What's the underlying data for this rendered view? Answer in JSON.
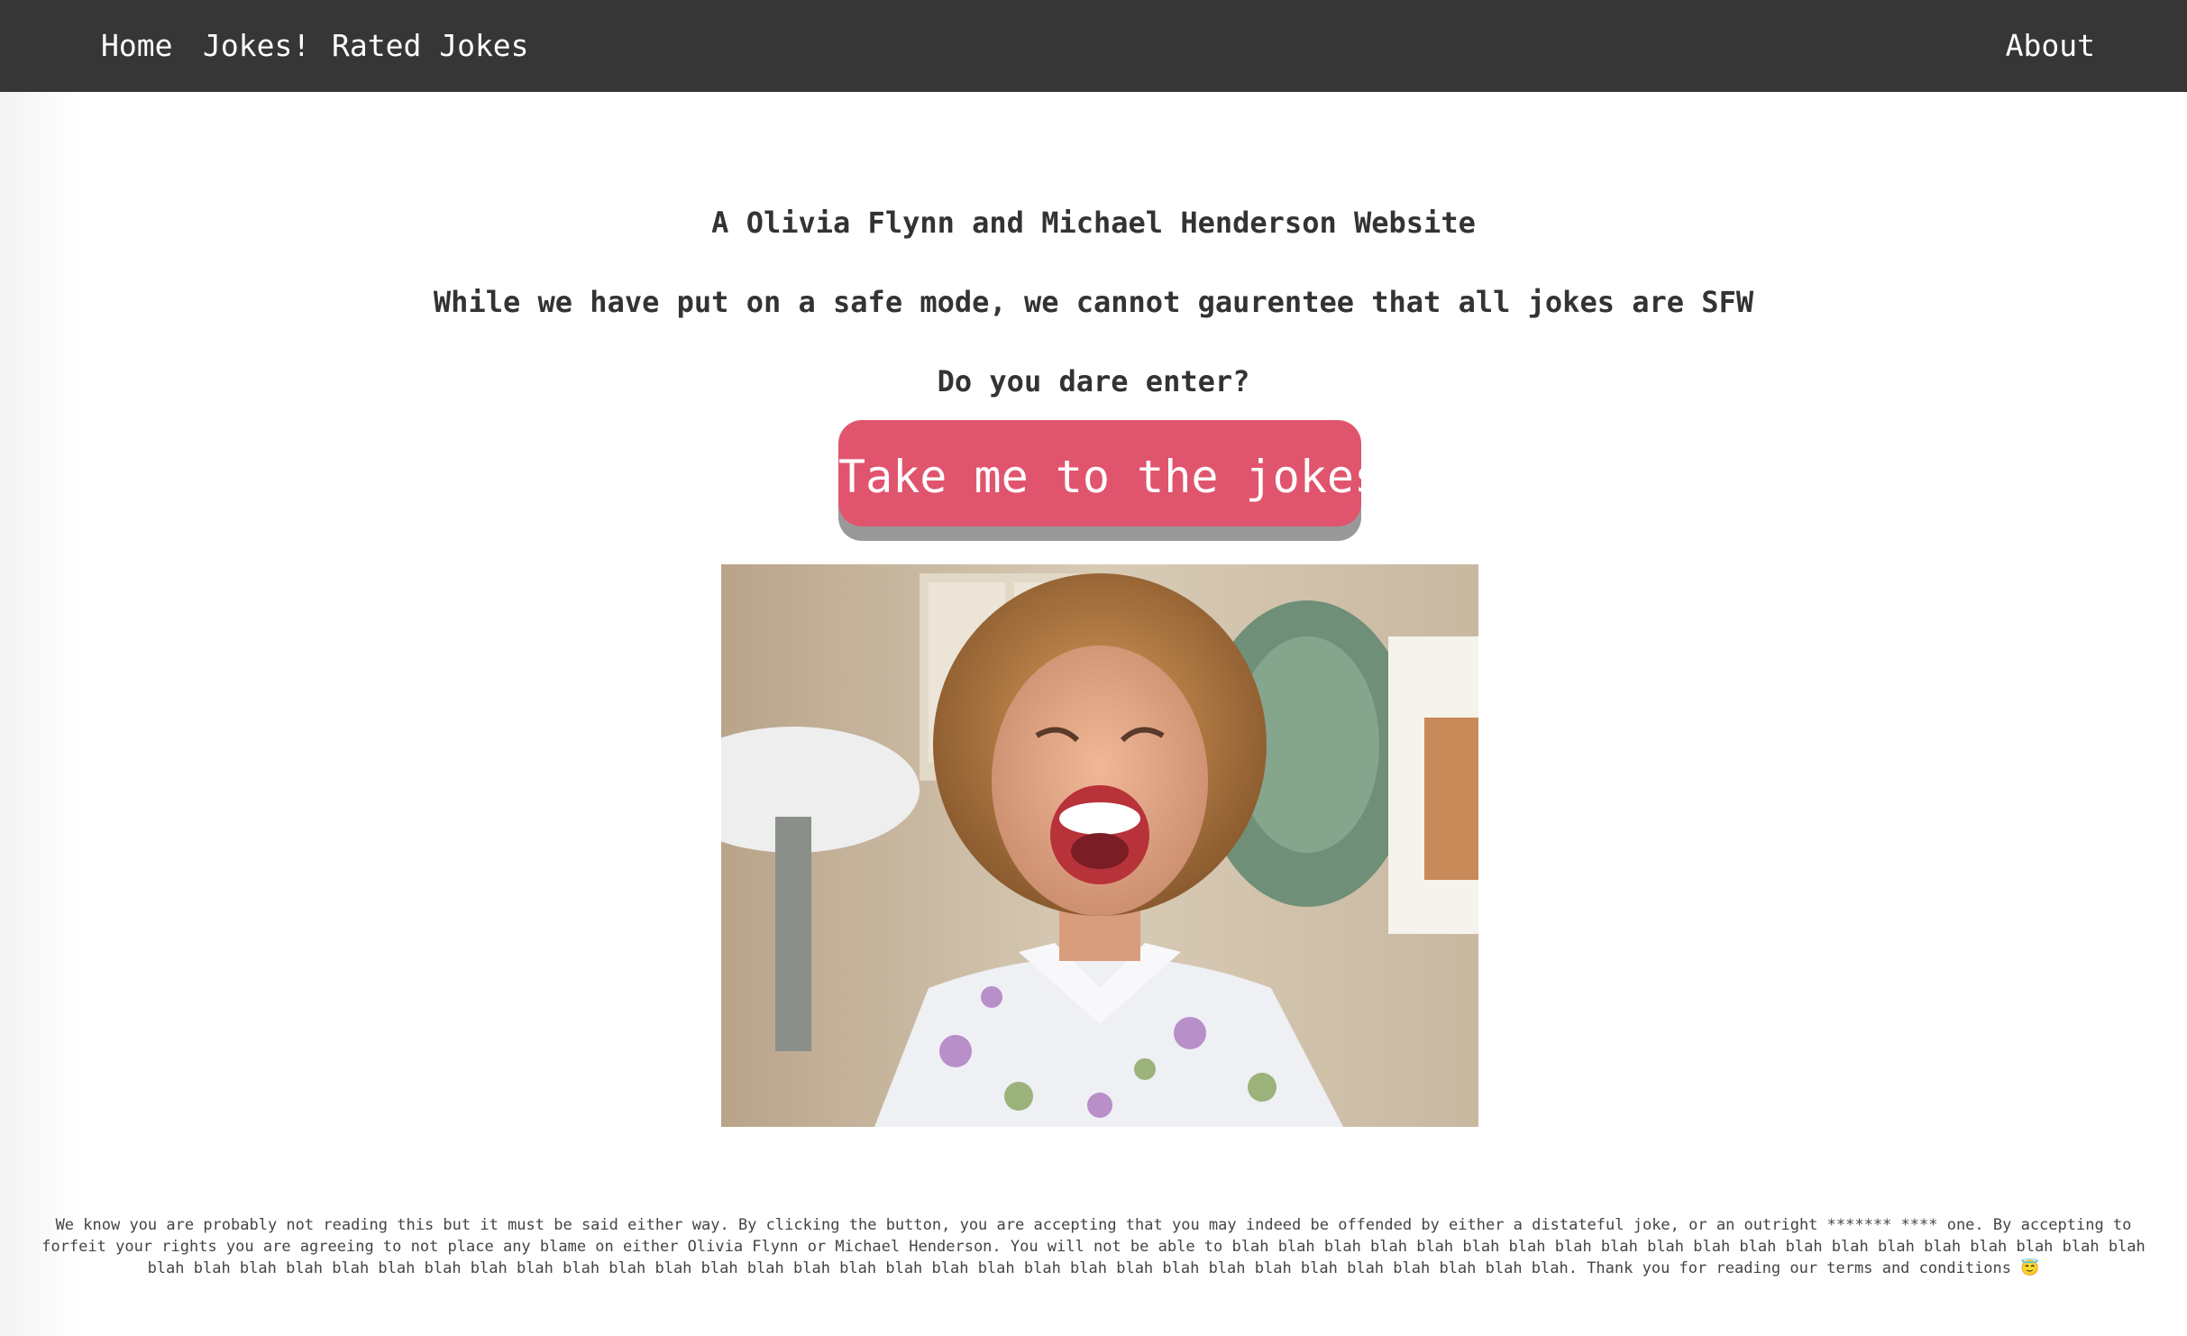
{
  "nav": {
    "home": "Home",
    "jokes": "Jokes!",
    "rated": "Rated Jokes",
    "about": "About"
  },
  "intro": {
    "line1": "A Olivia Flynn and Michael Henderson Website",
    "line2": "While we have put on a safe mode, we cannot gaurentee that all jokes are SFW",
    "line3": "Do you dare enter?"
  },
  "cta": {
    "label": "Take me to the jokes"
  },
  "image": {
    "subject": "laughing-woman-gif"
  },
  "disclaimer": {
    "text": "We know you are probably not reading this but it must be said either way. By clicking the button, you are accepting that you may indeed be offended by either a distateful joke, or an outright ******* **** one. By accepting to forfeit your rights you are agreeing to not place any blame on either Olivia Flynn or Michael Henderson. You will not be able to blah blah blah blah blah blah blah blah blah blah blah blah blah blah blah blah blah blah blah blah blah blah blah blah blah blah blah blah blah blah blah blah blah blah blah blah blah blah blah blah blah blah blah blah blah blah blah blah blah blah blah. Thank you for reading our terms and conditions 😇"
  },
  "colors": {
    "navbar": "#363636",
    "button": "#e0556d",
    "button_shadow": "#999999"
  }
}
